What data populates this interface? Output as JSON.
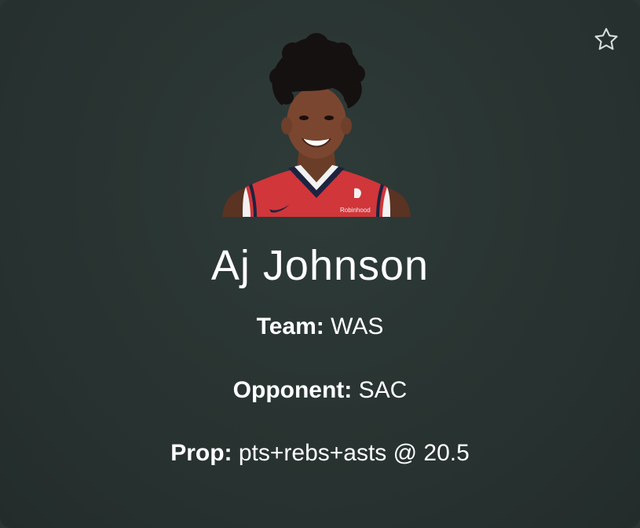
{
  "player": {
    "name": "Aj Johnson",
    "team_label": "Team:",
    "team": "WAS",
    "opponent_label": "Opponent:",
    "opponent": "SAC",
    "prop_label": "Prop:",
    "prop": "pts+rebs+asts @ 20.5",
    "jersey_sponsor": "Robinhood"
  },
  "icons": {
    "favorite": "star-outline-icon"
  },
  "colors": {
    "card_background": "#2a3533",
    "text": "#ffffff",
    "jersey_red": "#d0363a",
    "jersey_navy": "#1c2340"
  }
}
